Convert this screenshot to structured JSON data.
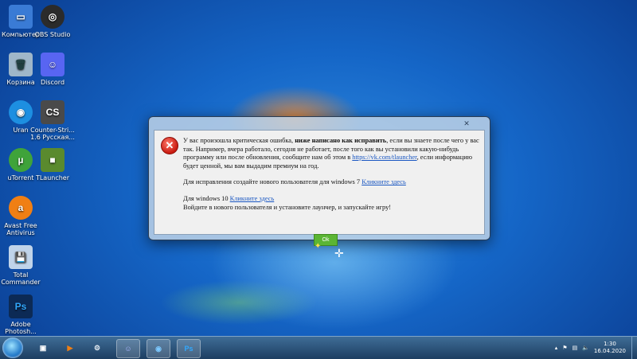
{
  "desktop": {
    "icons": [
      {
        "label": "Компьютер",
        "icon": "computer-icon",
        "color": "#3a7bd5"
      },
      {
        "label": "OBS Studio",
        "icon": "obs-icon",
        "color": "#2b2b2b"
      },
      {
        "label": "Корзина",
        "icon": "recycle-bin-icon",
        "color": "#9fb7c9"
      },
      {
        "label": "Discord",
        "icon": "discord-icon",
        "color": "#5865f2"
      },
      {
        "label": "Uran",
        "icon": "uran-icon",
        "color": "#1d8fe1"
      },
      {
        "label": "Counter-Stri... 1.6 Русская...",
        "icon": "counter-strike-icon",
        "color": "#4a4a4a"
      },
      {
        "label": "uTorrent",
        "icon": "utorrent-icon",
        "color": "#3fa33a"
      },
      {
        "label": "TLauncher",
        "icon": "tlauncher-icon",
        "color": "#5a8a2e"
      },
      {
        "label": "Avast Free Antivirus",
        "icon": "avast-icon",
        "color": "#f07f14"
      },
      {
        "label": "Total Commander",
        "icon": "total-commander-icon",
        "color": "#c0d4ea"
      },
      {
        "label": "Adobe Photosh...",
        "icon": "photoshop-icon",
        "color": "#0c2a55"
      }
    ]
  },
  "dialog": {
    "close_label": "✕",
    "message": {
      "line1_a": "У вас произошла критическая ошибка, ",
      "line1_bold": "ниже написано как исправить",
      "line1_b": ", если вы знаете после чего у вас так. Например, вчера работало, сегодня не работает, после того как вы установили какую-нибудь программу или после обновления, сообщите нам об этом в ",
      "vk_link": "https://vk.com/tlauncher",
      "line1_c": ", если информацию будет ценной, мы вам выдадим премиум на год.",
      "win7_text": "Для исправления создайте нового пользователя для windows 7 ",
      "win7_link": "Кликните здесь",
      "win10_text": "Для windows 10 ",
      "win10_link": "Кликните здесь",
      "win10_tail": "Войдите в нового пользователя и установите лаунчер, и запускайте игру!"
    },
    "ok_label": "Ok"
  },
  "taskbar": {
    "items": [
      {
        "name": "total-commander-taskbar-icon",
        "glyph": "▣",
        "color": "#2b5fb3"
      },
      {
        "name": "media-player-taskbar-icon",
        "glyph": "▶",
        "color": "#f07f14"
      },
      {
        "name": "steam-taskbar-icon",
        "glyph": "⚙",
        "color": "#1b2838"
      },
      {
        "name": "discord-taskbar-icon",
        "glyph": "☺",
        "color": "#5865f2"
      },
      {
        "name": "uran-taskbar-icon",
        "glyph": "◉",
        "color": "#1d8fe1"
      },
      {
        "name": "photoshop-taskbar-icon",
        "glyph": "Ps",
        "color": "#0c2a55"
      }
    ],
    "clock_time": "1:30",
    "clock_date": "16.04.2020"
  },
  "colors": {
    "accent": "#5bb534",
    "link": "#1a57c2",
    "error": "#c81a10"
  }
}
